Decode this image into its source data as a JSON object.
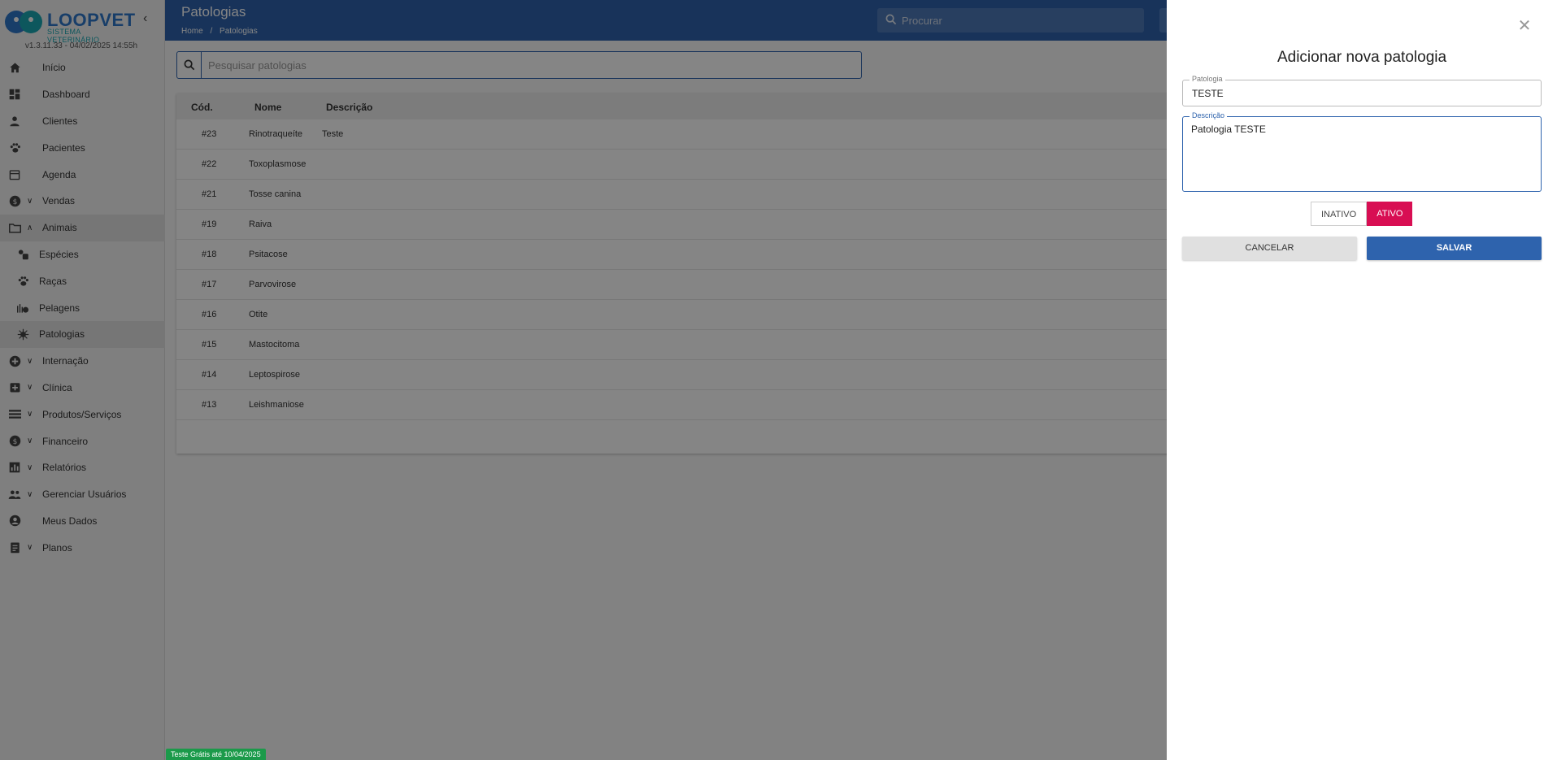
{
  "brand": {
    "name": "LOOPVET",
    "tagline": "SISTEMA VETERINÁRIO",
    "version": "v1.3.11.33 - 04/02/2025 14:55h"
  },
  "sidebar": {
    "items": [
      {
        "label": "Início",
        "icon": "home-icon"
      },
      {
        "label": "Dashboard",
        "icon": "dashboard-icon"
      },
      {
        "label": "Clientes",
        "icon": "person-icon"
      },
      {
        "label": "Pacientes",
        "icon": "paw-icon"
      },
      {
        "label": "Agenda",
        "icon": "calendar-icon"
      },
      {
        "label": "Vendas",
        "icon": "dollar-icon"
      },
      {
        "label": "Animais",
        "icon": "folder-icon"
      },
      {
        "label": "Espécies",
        "icon": "species-icon"
      },
      {
        "label": "Raças",
        "icon": "paw-icon"
      },
      {
        "label": "Pelagens",
        "icon": "fur-icon"
      },
      {
        "label": "Patologias",
        "icon": "virus-icon"
      },
      {
        "label": "Internação",
        "icon": "hospital-icon"
      },
      {
        "label": "Clínica",
        "icon": "clinic-icon"
      },
      {
        "label": "Produtos/Serviços",
        "icon": "list-icon"
      },
      {
        "label": "Financeiro",
        "icon": "dollar-icon"
      },
      {
        "label": "Relatórios",
        "icon": "chart-icon"
      },
      {
        "label": "Gerenciar Usuários",
        "icon": "group-icon"
      },
      {
        "label": "Meus Dados",
        "icon": "account-icon"
      },
      {
        "label": "Planos",
        "icon": "clipboard-icon"
      }
    ]
  },
  "header": {
    "title": "Patologias",
    "breadcrumb": [
      "Home",
      "/",
      "Patologias"
    ],
    "search_placeholder": "Procurar"
  },
  "list": {
    "search_placeholder": "Pesquisar patologias",
    "columns": [
      "Cód.",
      "Nome",
      "Descrição"
    ],
    "rows": [
      {
        "code": "#23",
        "name": "Rinotraqueíte",
        "desc": "Teste"
      },
      {
        "code": "#22",
        "name": "Toxoplasmose",
        "desc": ""
      },
      {
        "code": "#21",
        "name": "Tosse canina",
        "desc": ""
      },
      {
        "code": "#19",
        "name": "Raiva",
        "desc": ""
      },
      {
        "code": "#18",
        "name": "Psitacose",
        "desc": ""
      },
      {
        "code": "#17",
        "name": "Parvovirose",
        "desc": ""
      },
      {
        "code": "#16",
        "name": "Otite",
        "desc": ""
      },
      {
        "code": "#15",
        "name": "Mastocitoma",
        "desc": ""
      },
      {
        "code": "#14",
        "name": "Leptospirose",
        "desc": ""
      },
      {
        "code": "#13",
        "name": "Leishmaniose",
        "desc": ""
      }
    ]
  },
  "trial_badge": "Teste Grátis até 10/04/2025",
  "drawer": {
    "title": "Adicionar nova patologia",
    "pathology_label": "Patologia",
    "pathology_value": "TESTE",
    "description_label": "Descrição",
    "description_value": "Patologia TESTE",
    "status_inactive": "INATIVO",
    "status_active": "ATIVO",
    "cancel_label": "CANCELAR",
    "save_label": "SALVAR"
  },
  "colors": {
    "primary": "#2e63ad",
    "active_toggle": "#d80e53",
    "trial_badge": "#1b9a4a"
  }
}
